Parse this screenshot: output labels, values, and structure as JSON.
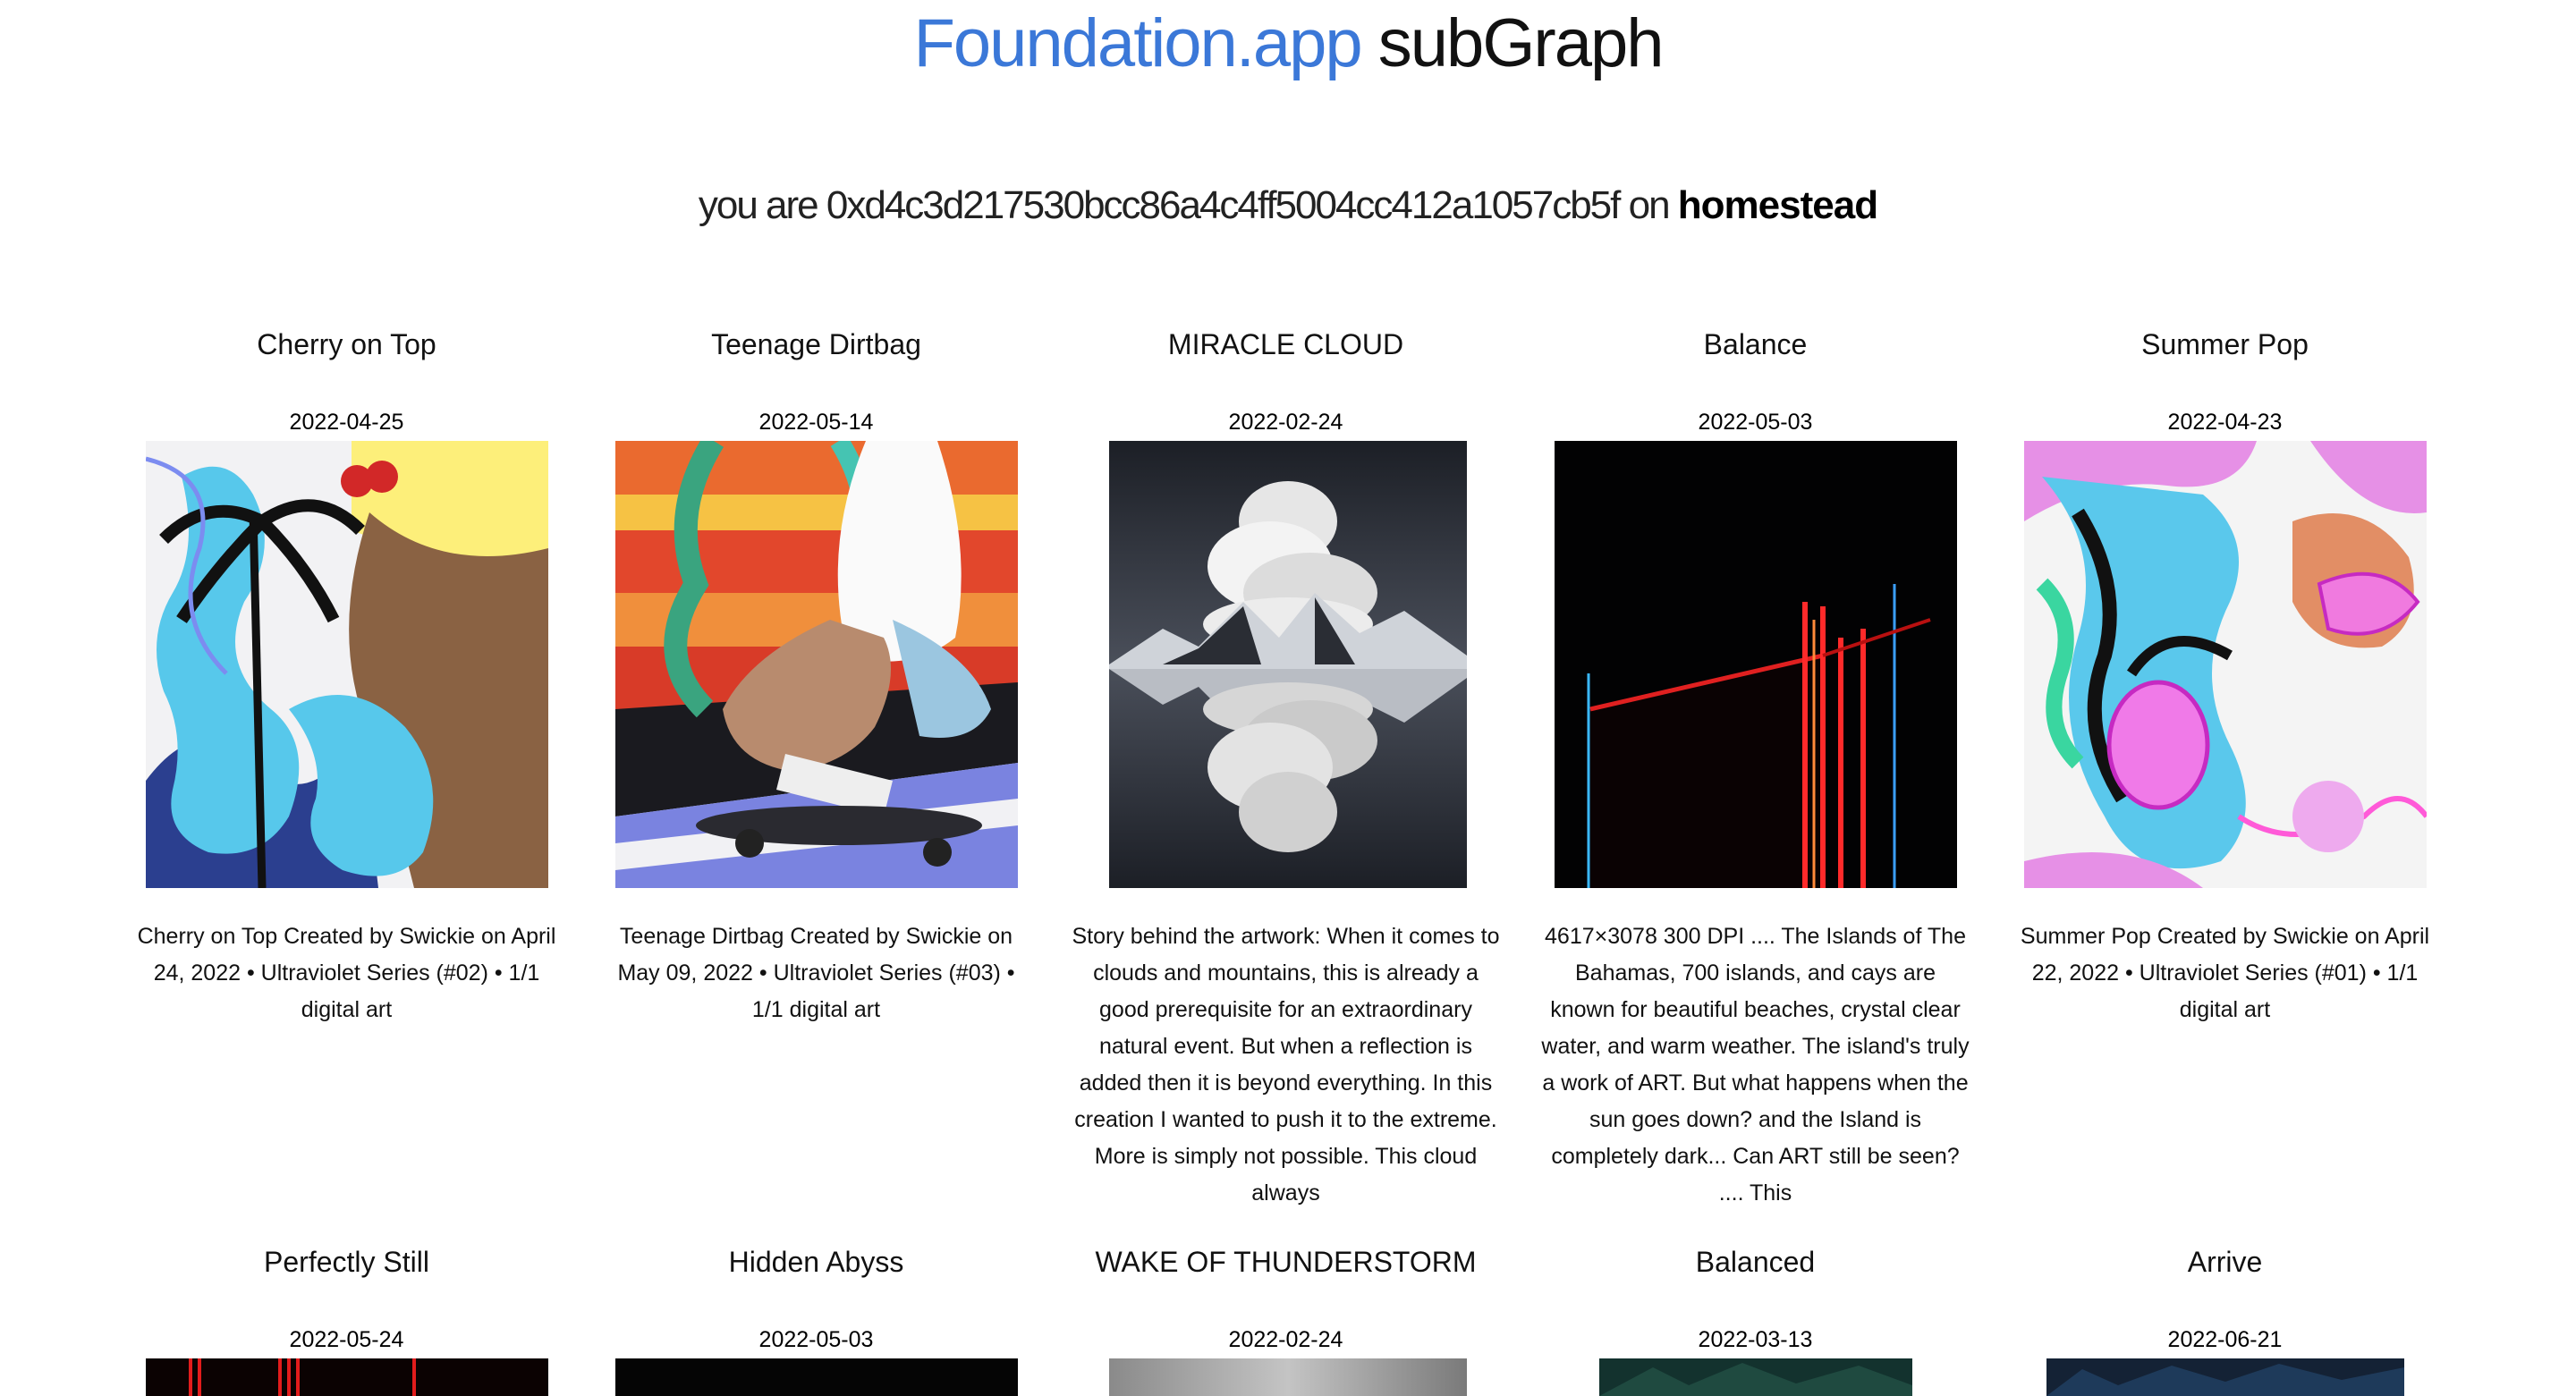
{
  "header": {
    "brand": "Foundation.app",
    "subtitle": "subGraph"
  },
  "identity": {
    "prefix": "you are",
    "address": "0xd4c3d217530bcc86a4c4ff5004cc412a1057cb5f",
    "connector": "on",
    "network": "homestead"
  },
  "nfts": [
    {
      "title": "Cherry on Top",
      "date": "2022-04-25",
      "image": "cherry-artwork",
      "description": "Cherry on Top Created by Swickie on April 24, 2022 • Ultraviolet Series (#02) • 1/1 digital art"
    },
    {
      "title": "Teenage Dirtbag",
      "date": "2022-05-14",
      "image": "skateboard-artwork",
      "description": "Teenage Dirtbag Created by Swickie on May 09, 2022 • Ultraviolet Series (#03) • 1/1 digital art"
    },
    {
      "title": "MIRACLE CLOUD",
      "date": "2022-02-24",
      "image": "cloud-reflection-artwork",
      "description": "Story behind the artwork: When it comes to clouds and mountains, this is already a good prerequisite for an extraordinary natural event. But when a reflection is added then it is beyond everything. In this creation I wanted to push it to the extreme. More is simply not possible. This cloud always"
    },
    {
      "title": "Balance",
      "date": "2022-05-03",
      "image": "neon-lines-artwork",
      "description": "4617×3078 300 DPI .... The Islands of The Bahamas, 700 islands, and cays are known for beautiful beaches, crystal clear water, and warm weather. The island's truly a work of ART. But what happens when the sun goes down? and the Island is completely dark... Can ART still be seen? .... This"
    },
    {
      "title": "Summer Pop",
      "date": "2022-04-23",
      "image": "summer-pop-artwork",
      "description": "Summer Pop Created by Swickie on April 22, 2022 • Ultraviolet Series (#01) • 1/1 digital art"
    },
    {
      "title": "Perfectly Still",
      "date": "2022-05-24",
      "image": "red-light-artwork",
      "description": ""
    },
    {
      "title": "Hidden Abyss",
      "date": "2022-05-03",
      "image": "dark-artwork",
      "description": ""
    },
    {
      "title": "WAKE OF THUNDERSTORM",
      "date": "2022-02-24",
      "image": "gray-sky-artwork",
      "description": ""
    },
    {
      "title": "Balanced",
      "date": "2022-03-13",
      "image": "teal-forest-artwork",
      "description": ""
    },
    {
      "title": "Arrive",
      "date": "2022-06-21",
      "image": "night-blue-artwork",
      "description": ""
    }
  ]
}
